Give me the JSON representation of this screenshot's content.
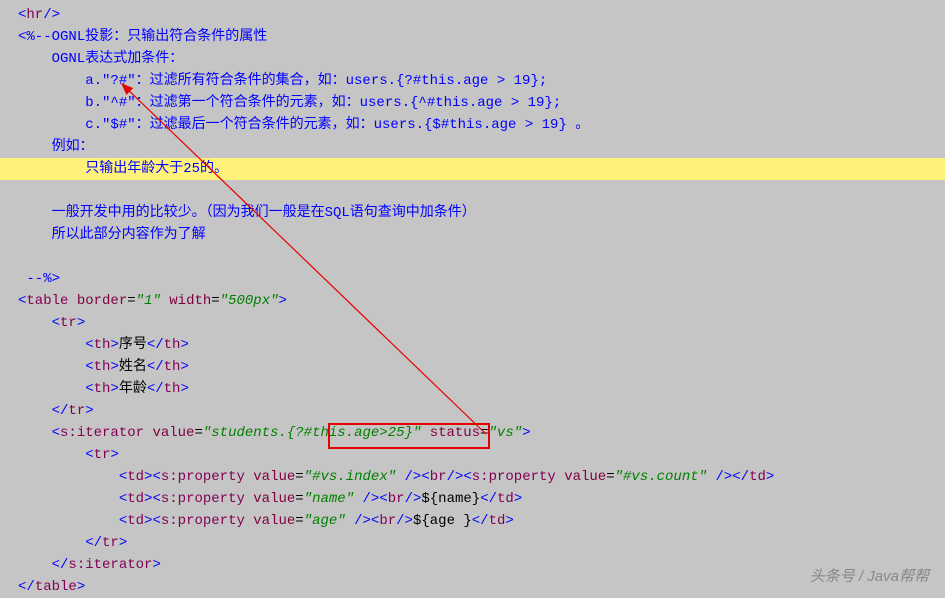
{
  "lines": {
    "l1_hr_open": "<",
    "l1_hr_tag": "hr",
    "l1_hr_close": "/>",
    "l2_open": "<%--",
    "l2_text": "OGNL投影：只输出符合条件的属性",
    "l3": "    OGNL表达式加条件：",
    "l4": "        a.\"?#\"：过滤所有符合条件的集合，如：users.{?#this.age > 19};",
    "l5": "        b.\"^#\"：过滤第一个符合条件的元素，如：users.{^#this.age > 19};",
    "l6": "        c.\"$#\"：过滤最后一个符合条件的元素，如：users.{$#this.age > 19} 。",
    "l7": "    例如：",
    "l8": "        只输出年龄大于25的。",
    "l9": "    一般开发中用的比较少。（因为我们一般是在SQL语句查询中加条件）",
    "l10": "    所以此部分内容作为了解",
    "l11": " --%>",
    "table_open_lt": "<",
    "table_tag": "table",
    "border_attr": "border",
    "border_val": "\"1\"",
    "width_attr": "width",
    "width_val": "\"500px\"",
    "gt": ">",
    "tr_open_lt": "<",
    "tr_tag": "tr",
    "th_tag": "th",
    "th_close": "</",
    "col1": "序号",
    "col2": "姓名",
    "col3": "年龄",
    "tr_close": "</tr>",
    "iter_open": "<",
    "iter_tag": "s:iterator",
    "value_attr": "value",
    "iter_val": "\"students.{?#this.age>25}\"",
    "status_attr": "status",
    "status_val": "\"vs\"",
    "td_tag": "td",
    "prop_tag": "s:property",
    "idx_val": "\"#vs.index\"",
    "br_tag": "br",
    "count_val": "\"#vs.count\"",
    "name_val": "\"name\"",
    "name_expr": "${name}",
    "age_val": "\"age\"",
    "age_expr": "${age }",
    "iter_close": "</s:iterator>",
    "table_close": "</table>"
  },
  "watermark": "头条号 / Java帮帮"
}
